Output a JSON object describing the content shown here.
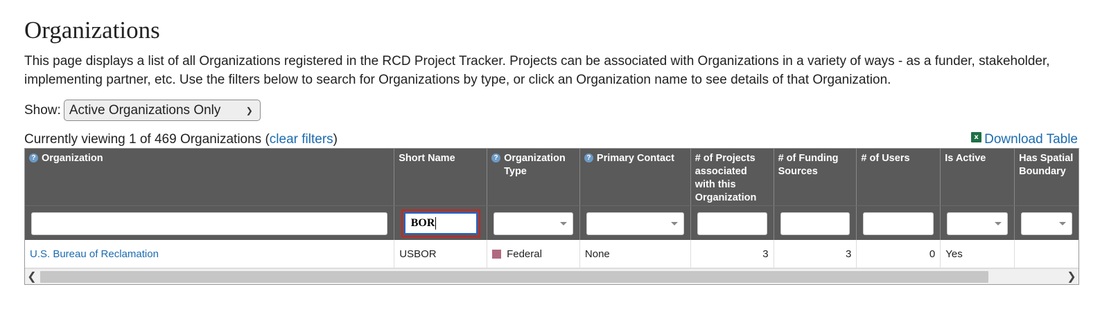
{
  "page": {
    "title": "Organizations",
    "description": "This page displays a list of all Organizations registered in the RCD Project Tracker. Projects can be associated with Organizations in a variety of ways - as a funder, stakeholder, implementing partner, etc. Use the filters below to search for Organizations by type, or click an Organization name to see details of that Organization."
  },
  "show_filter": {
    "label": "Show:",
    "selected": "Active Organizations Only"
  },
  "status": {
    "viewing_prefix": "Currently viewing 1 of 469 Organizations (",
    "clear_filters": "clear filters",
    "viewing_suffix": ")",
    "download_label": "Download Table",
    "download_icon": "excel-icon"
  },
  "table": {
    "columns": [
      {
        "key": "organization",
        "label": "Organization",
        "help": true
      },
      {
        "key": "short_name",
        "label": "Short Name",
        "help": false
      },
      {
        "key": "org_type",
        "label": "Organization Type",
        "help": true
      },
      {
        "key": "primary_contact",
        "label": "Primary Contact",
        "help": true
      },
      {
        "key": "num_projects",
        "label": "# of Projects associated with this Organization",
        "help": false
      },
      {
        "key": "num_funding",
        "label": "# of Funding Sources",
        "help": false
      },
      {
        "key": "num_users",
        "label": "# of Users",
        "help": false
      },
      {
        "key": "is_active",
        "label": "Is Active",
        "help": false
      },
      {
        "key": "spatial",
        "label": "Has Spatial Boundary",
        "help": false
      }
    ],
    "filters": {
      "short_name_value": "BOR"
    },
    "rows": [
      {
        "organization": "U.S. Bureau of Reclamation",
        "short_name": "USBOR",
        "org_type": "Federal",
        "org_type_color": "#b06a7f",
        "primary_contact": "None",
        "num_projects": "3",
        "num_funding": "3",
        "num_users": "0",
        "is_active": "Yes",
        "spatial": ""
      }
    ]
  },
  "colors": {
    "header_bg": "#5a5a5a",
    "link": "#1b6bb0",
    "highlight_border": "#d32020",
    "focus_border": "#2563c9"
  }
}
